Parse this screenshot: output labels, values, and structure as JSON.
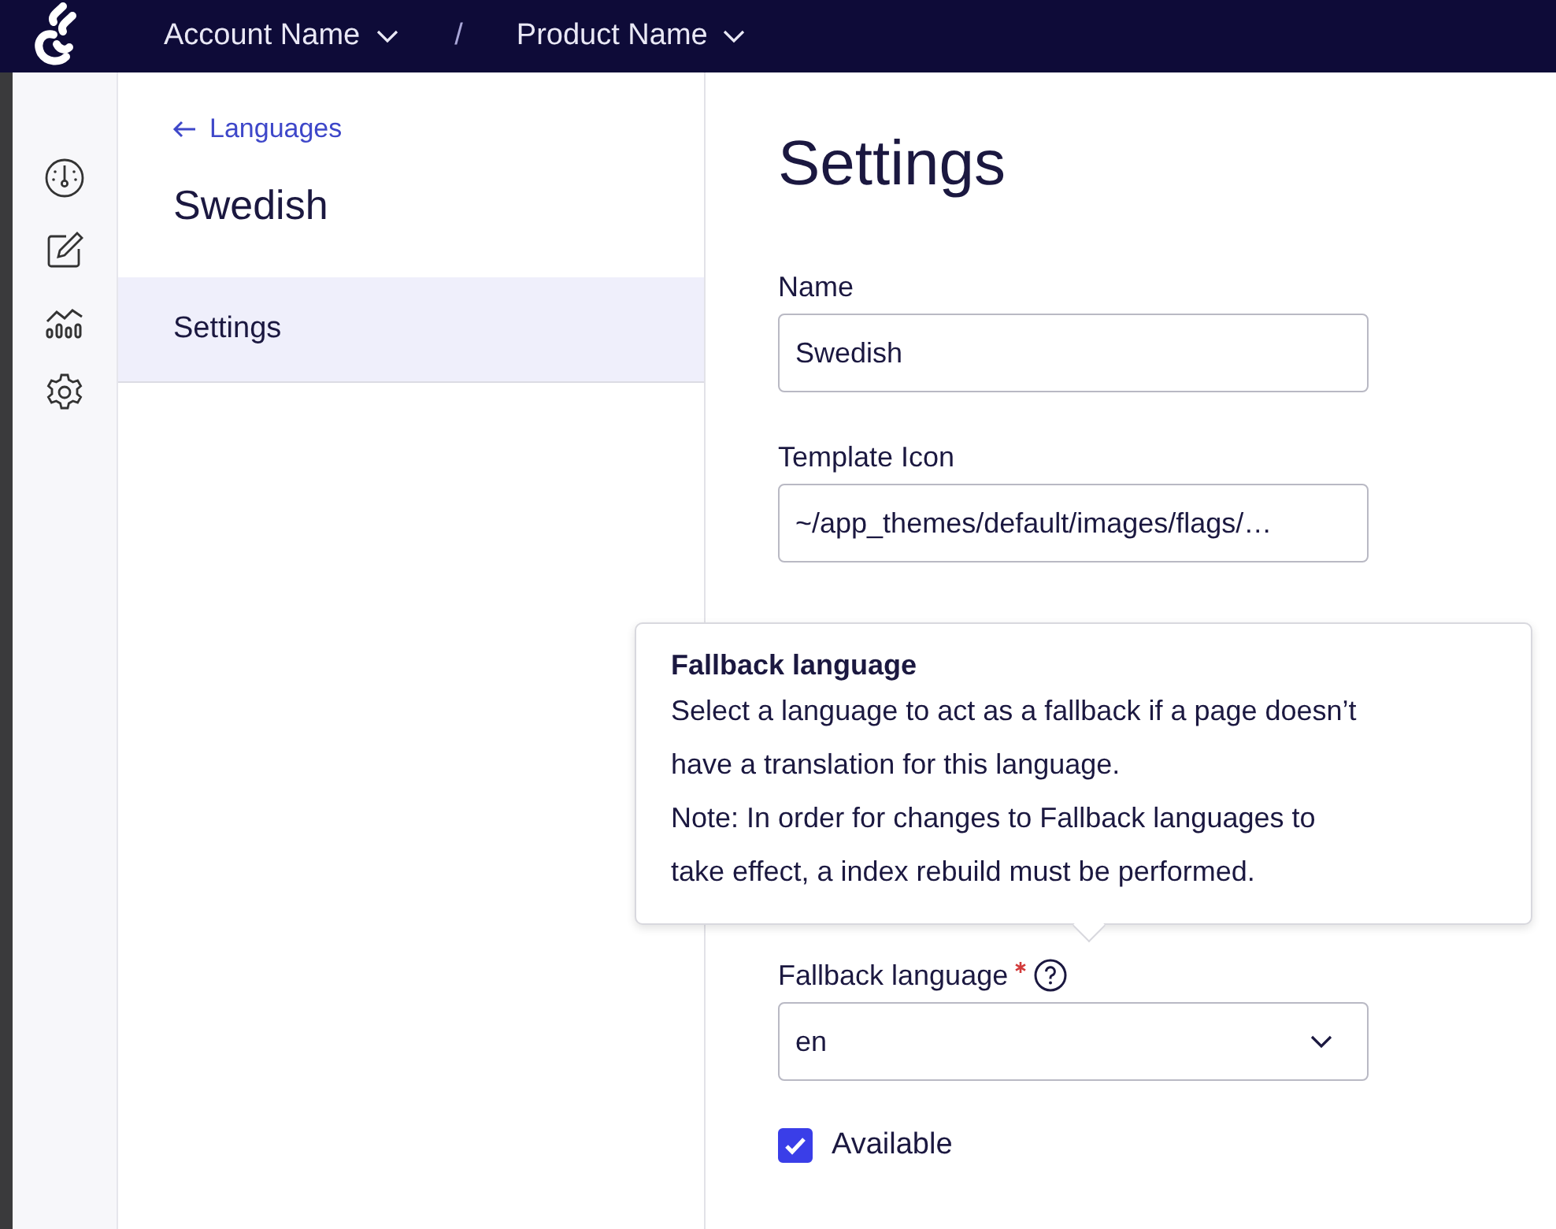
{
  "top_bar": {
    "account": "Account Name",
    "separator": "/",
    "product": "Product Name"
  },
  "sidebar": {
    "back_link": "Languages",
    "title": "Swedish",
    "items": [
      {
        "label": "Settings",
        "selected": true
      }
    ]
  },
  "main": {
    "title": "Settings",
    "fields": [
      {
        "kind": "text",
        "label": "Name",
        "required": false,
        "help": false,
        "value": "Swedish"
      },
      {
        "kind": "text",
        "label": "Template Icon",
        "required": false,
        "help": false,
        "value": "~/app_themes/default/images/flags/…"
      },
      {
        "kind": "select",
        "label": "Fallback language",
        "required": true,
        "help": true,
        "value": "en"
      }
    ],
    "checkbox": {
      "label": "Available",
      "checked": true
    },
    "tooltip": {
      "title": "Fallback language",
      "paragraphs": [
        "Select a language to act as a fallback if a page doesn’t have a translation for this language.",
        "Note: In order for changes to Fallback languages to take effect, a index rebuild must be performed."
      ]
    }
  }
}
